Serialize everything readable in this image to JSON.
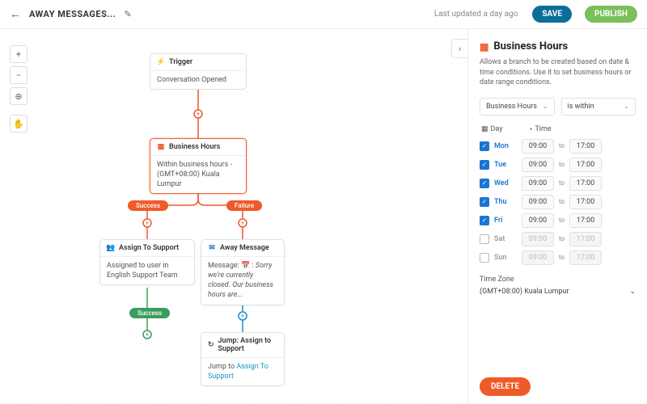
{
  "header": {
    "title": "AWAY MESSAGES...",
    "updated": "Last updated a day ago",
    "save": "SAVE",
    "publish": "PUBLISH"
  },
  "nodes": {
    "trigger": {
      "title": "Trigger",
      "body": "Conversation Opened"
    },
    "bh": {
      "title": "Business Hours",
      "body": "Within business hours - (GMT+08:00) Kuala Lumpur"
    },
    "assign": {
      "title": "Assign To Support",
      "body": "Assigned to user in English Support Team"
    },
    "away": {
      "title": "Away Message",
      "body_prefix": "Message: 📅 : ",
      "body_text": "Sorry we're currently closed. Our business hours are..."
    },
    "jump": {
      "title": "Jump: Assign to Support",
      "prefix": "Jump to ",
      "link": "Assign To Support"
    }
  },
  "pills": {
    "success": "Success",
    "failure": "Failure",
    "success2": "Success"
  },
  "sidebar": {
    "title": "Business Hours",
    "desc": "Allows a branch to be created based on date & time conditions. Use it to set business hours or date range conditions.",
    "sel1": "Business Hours",
    "sel2": "is within",
    "day_header": "Day",
    "time_header": "Time",
    "to": "to",
    "tz_label": "Time Zone",
    "tz_value": "(GMT+08:00) Kuala Lumpur",
    "delete": "DELETE",
    "days": [
      {
        "label": "Mon",
        "on": true,
        "from": "09:00",
        "to": "17:00"
      },
      {
        "label": "Tue",
        "on": true,
        "from": "09:00",
        "to": "17:00"
      },
      {
        "label": "Wed",
        "on": true,
        "from": "09:00",
        "to": "17:00"
      },
      {
        "label": "Thu",
        "on": true,
        "from": "09:00",
        "to": "17:00"
      },
      {
        "label": "Fri",
        "on": true,
        "from": "09:00",
        "to": "17:00"
      },
      {
        "label": "Sat",
        "on": false,
        "from": "09:00",
        "to": "17:00"
      },
      {
        "label": "Sun",
        "on": false,
        "from": "09:00",
        "to": "17:00"
      }
    ]
  }
}
